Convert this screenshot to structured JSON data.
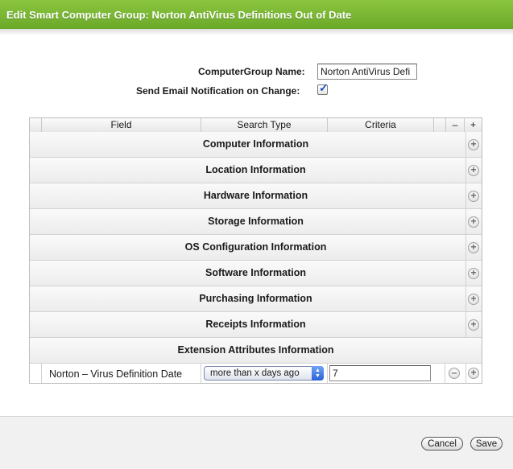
{
  "window": {
    "title": "Edit Smart Computer Group: Norton AntiVirus Definitions Out of Date"
  },
  "form": {
    "name_label": "ComputerGroup Name:",
    "name_value": "Norton AntiVirus Defi",
    "email_label": "Send Email Notification on Change:",
    "email_checked": true
  },
  "table": {
    "headers": {
      "field": "Field",
      "search_type": "Search Type",
      "criteria": "Criteria",
      "minus": "–",
      "plus": "+"
    },
    "sections": [
      "Computer Information",
      "Location Information",
      "Hardware Information",
      "Storage Information",
      "OS Configuration Information",
      "Software Information",
      "Purchasing Information",
      "Receipts Information",
      "Extension Attributes Information"
    ],
    "criterion": {
      "field": "Norton – Virus Definition Date",
      "search_type": "more than x days ago",
      "value": "7"
    }
  },
  "footer": {
    "cancel_label": "Cancel",
    "save_label": "Save"
  },
  "icons": {
    "plus": "plus-circle-icon",
    "minus": "minus-circle-icon",
    "check": "checkmark-icon",
    "select_arrows": "updown-arrows-icon"
  },
  "colors": {
    "title_bar": "#7ab833",
    "accent_blue": "#2a62d6"
  }
}
